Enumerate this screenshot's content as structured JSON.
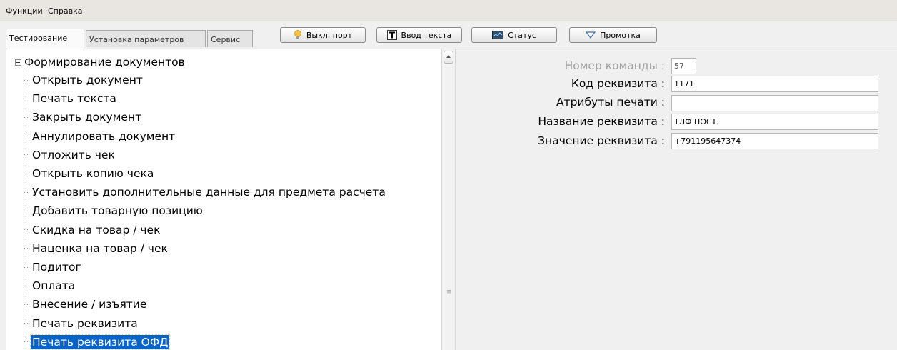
{
  "menu": {
    "items": [
      "Функции",
      "Справка"
    ]
  },
  "tabs": [
    "Тестирование",
    "Установка параметров",
    "Сервис"
  ],
  "toolbar": {
    "port_label": "Выкл. порт",
    "text_label": "Ввод текста",
    "status_label": "Статус",
    "feed_label": "Промотка",
    "icons": [
      "lightbulb-icon",
      "text-T-icon",
      "monitor-icon",
      "chevron-down-icon"
    ],
    "bulb_color": "#f5c242"
  },
  "tree": {
    "root": "Формирование документов",
    "items": [
      "Открыть документ",
      "Печать текста",
      "Закрыть документ",
      "Аннулировать документ",
      "Отложить чек",
      "Открыть копию чека",
      "Установить дополнительные данные для предмета расчета",
      "Добавить товарную позицию",
      "Скидка на товар / чек",
      "Наценка на товар / чек",
      "Подитог",
      "Оплата",
      "Внесение / изъятие",
      "Печать реквизита",
      "Печать реквизита ОФД"
    ],
    "selected_index": 14,
    "selection_color": "#0a64c8"
  },
  "form": {
    "cmd_number_label": "Номер команды :",
    "cmd_number_value": "57",
    "req_code_label": "Код реквизита :",
    "req_code_value": "1171",
    "print_attrs_label": "Атрибуты печати :",
    "print_attrs_value": "",
    "req_name_label": "Название реквизита :",
    "req_name_value": "ТЛФ ПОСТ.",
    "req_value_label": "Значение реквизита :",
    "req_value_value": "+791195647374"
  }
}
